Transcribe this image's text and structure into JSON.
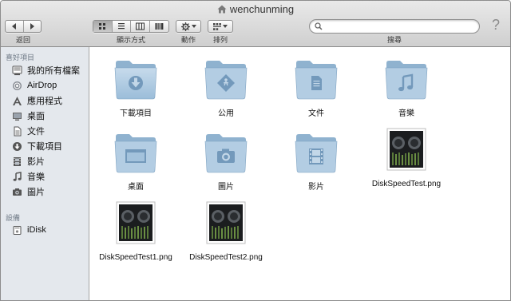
{
  "window": {
    "title": "wenchunming"
  },
  "toolbar": {
    "back_label": "返回",
    "view_label": "顯示方式",
    "action_label": "動作",
    "arrange_label": "排列",
    "search_label": "搜尋",
    "search_placeholder": "",
    "help_symbol": "?"
  },
  "sidebar": {
    "favorites_heading": "喜好項目",
    "items": [
      {
        "label": "我的所有檔案",
        "icon": "all-files-icon"
      },
      {
        "label": "AirDrop",
        "icon": "airdrop-icon"
      },
      {
        "label": "應用程式",
        "icon": "applications-icon"
      },
      {
        "label": "桌面",
        "icon": "desktop-icon"
      },
      {
        "label": "文件",
        "icon": "documents-icon"
      },
      {
        "label": "下載項目",
        "icon": "downloads-icon"
      },
      {
        "label": "影片",
        "icon": "movies-icon"
      },
      {
        "label": "音樂",
        "icon": "music-icon"
      },
      {
        "label": "圖片",
        "icon": "pictures-icon"
      }
    ],
    "devices_heading": "設備",
    "devices": [
      {
        "label": "iDisk",
        "icon": "idisk-icon"
      }
    ]
  },
  "files": [
    {
      "name": "下載項目",
      "kind": "folder",
      "glyph": "download"
    },
    {
      "name": "公用",
      "kind": "folder",
      "glyph": "public"
    },
    {
      "name": "文件",
      "kind": "folder",
      "glyph": "documents"
    },
    {
      "name": "音樂",
      "kind": "folder",
      "glyph": "music"
    },
    {
      "name": "桌面",
      "kind": "folder",
      "glyph": "desktop"
    },
    {
      "name": "圖片",
      "kind": "folder",
      "glyph": "pictures"
    },
    {
      "name": "影片",
      "kind": "folder",
      "glyph": "movies"
    },
    {
      "name": "DiskSpeedTest.png",
      "kind": "image"
    },
    {
      "name": "DiskSpeedTest1.png",
      "kind": "image"
    },
    {
      "name": "DiskSpeedTest2.png",
      "kind": "image"
    }
  ],
  "colors": {
    "folder_light": "#c3d7e8",
    "folder_dark": "#8db1cf",
    "glyph": "#6f95b6",
    "sidebar_bg": "#e4e8ed"
  }
}
